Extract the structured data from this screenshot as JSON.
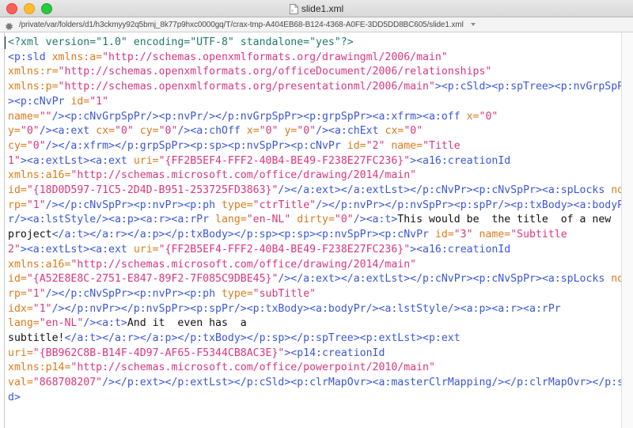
{
  "window": {
    "title": "slide1.xml",
    "doc_icon": "xml-document-icon",
    "traffic_lights": {
      "close_label": "Close",
      "minimize_label": "Minimize",
      "maximize_label": "Maximize",
      "close_color": "#ff5f57",
      "minimize_color": "#ffbd2e",
      "maximize_color": "#28c840"
    }
  },
  "pathbar": {
    "gear_icon": "gear-icon",
    "path": "/private/var/folders/d1/h3ckmyy92q5bmj_8k77p9hxc0000gq/T/crax-tmp-A404EB68-B124-4368-A0FE-3DD5DD8BC605/slide1.xml",
    "chevron_icon": "chevron-down-icon"
  },
  "colors": {
    "tag": "#3b57d8",
    "attribute": "#d97b1c",
    "value": "#d9377e",
    "text": "#111111",
    "processing_instruction": "#1f7a6c",
    "background": "#ffffff"
  },
  "document": {
    "filename": "slide1.xml",
    "declaration": "<?xml version=\"1.0\" encoding=\"UTF-8\" standalone=\"yes\"?>",
    "slide_title_text": "This would be  the title  of a new project",
    "slide_subtitle_text": "And it  even has  a subtitle!",
    "creation_id_val": "868708207",
    "title_uri": "{FF2B5EF4-FFF2-40B4-BE49-F238E27FC236}",
    "title_creation_id": "{18D0D597-71C5-2D4D-B951-253725FD3863}",
    "subtitle_creation_id": "{A52E8E8C-2751-E847-89F2-7F085C9DBE45}",
    "p14_ext_uri": "{BB962C8B-B14F-4D97-AF65-F5344CB8AC3E}",
    "ns_a": "http://schemas.openxmlformats.org/drawingml/2006/main",
    "ns_r": "http://schemas.openxmlformats.org/officeDocument/2006/relationships",
    "ns_p": "http://schemas.openxmlformats.org/presentationml/2006/main",
    "ns_a16": "http://schemas.microsoft.com/office/drawing/2014/main",
    "ns_p14": "http://schemas.microsoft.com/office/powerpoint/2010/main",
    "tokens": [
      {
        "t": "pi",
        "s": "<?xml version=\"1.0\" encoding=\"UTF-8\" standalone=\"yes\"?>\n"
      },
      {
        "t": "tag",
        "s": "<p:sld "
      },
      {
        "t": "attr",
        "s": "xmlns:a="
      },
      {
        "t": "val",
        "s": "\"http://schemas.openxmlformats.org/drawingml/2006/main\"\n"
      },
      {
        "t": "attr",
        "s": "xmlns:r="
      },
      {
        "t": "val",
        "s": "\"http://schemas.openxmlformats.org/officeDocument/2006/relationships\"\n"
      },
      {
        "t": "attr",
        "s": "xmlns:p="
      },
      {
        "t": "val",
        "s": "\"http://schemas.openxmlformats.org/presentationml/2006/main\""
      },
      {
        "t": "tag",
        "s": "><p:cSld><p:spTree><p:nvGrpSpPr><p:cNvPr "
      },
      {
        "t": "attr",
        "s": "id="
      },
      {
        "t": "val",
        "s": "\"1\"\n"
      },
      {
        "t": "attr",
        "s": "name="
      },
      {
        "t": "val",
        "s": "\"\""
      },
      {
        "t": "tag",
        "s": "/><p:cNvGrpSpPr/><p:nvPr/></p:nvGrpSpPr><p:grpSpPr><a:xfrm><a:off "
      },
      {
        "t": "attr",
        "s": "x="
      },
      {
        "t": "val",
        "s": "\"0\"\n"
      },
      {
        "t": "attr",
        "s": "y="
      },
      {
        "t": "val",
        "s": "\"0\""
      },
      {
        "t": "tag",
        "s": "/><a:ext "
      },
      {
        "t": "attr",
        "s": "cx="
      },
      {
        "t": "val",
        "s": "\"0\" "
      },
      {
        "t": "attr",
        "s": "cy="
      },
      {
        "t": "val",
        "s": "\"0\""
      },
      {
        "t": "tag",
        "s": "/><a:chOff "
      },
      {
        "t": "attr",
        "s": "x="
      },
      {
        "t": "val",
        "s": "\"0\" "
      },
      {
        "t": "attr",
        "s": "y="
      },
      {
        "t": "val",
        "s": "\"0\""
      },
      {
        "t": "tag",
        "s": "/><a:chExt "
      },
      {
        "t": "attr",
        "s": "cx="
      },
      {
        "t": "val",
        "s": "\"0\"\n"
      },
      {
        "t": "attr",
        "s": "cy="
      },
      {
        "t": "val",
        "s": "\"0\""
      },
      {
        "t": "tag",
        "s": "/></a:xfrm></p:grpSpPr><p:sp><p:nvSpPr><p:cNvPr "
      },
      {
        "t": "attr",
        "s": "id="
      },
      {
        "t": "val",
        "s": "\"2\" "
      },
      {
        "t": "attr",
        "s": "name="
      },
      {
        "t": "val",
        "s": "\"Title\n1\""
      },
      {
        "t": "tag",
        "s": "><a:extLst><a:ext "
      },
      {
        "t": "attr",
        "s": "uri="
      },
      {
        "t": "val",
        "s": "\"{FF2B5EF4-FFF2-40B4-BE49-F238E27FC236}\""
      },
      {
        "t": "tag",
        "s": "><a16:creationId\n"
      },
      {
        "t": "attr",
        "s": "xmlns:a16="
      },
      {
        "t": "val",
        "s": "\"http://schemas.microsoft.com/office/drawing/2014/main\"\n"
      },
      {
        "t": "attr",
        "s": "id="
      },
      {
        "t": "val",
        "s": "\"{18D0D597-71C5-2D4D-B951-253725FD3863}\""
      },
      {
        "t": "tag",
        "s": "/></a:ext></a:extLst></p:cNvPr><p:cNvSpPr><a:spLocks "
      },
      {
        "t": "attr",
        "s": "noGrp="
      },
      {
        "t": "val",
        "s": "\"1\""
      },
      {
        "t": "tag",
        "s": "/></p:cNvSpPr><p:nvPr><p:ph "
      },
      {
        "t": "attr",
        "s": "type="
      },
      {
        "t": "val",
        "s": "\"ctrTitle\""
      },
      {
        "t": "tag",
        "s": "/></p:nvPr></p:nvSpPr><p:spPr/><p:txBody><a:bodyPr/><a:lstStyle/><a:p><a:r><a:rPr "
      },
      {
        "t": "attr",
        "s": "lang="
      },
      {
        "t": "val",
        "s": "\"en-NL\" "
      },
      {
        "t": "attr",
        "s": "dirty="
      },
      {
        "t": "val",
        "s": "\"0\""
      },
      {
        "t": "tag",
        "s": "/><a:t>"
      },
      {
        "t": "txt",
        "s": "This would be  the title  of a new\nproject"
      },
      {
        "t": "tag",
        "s": "</a:t></a:r></a:p></p:txBody></p:sp><p:sp><p:nvSpPr><p:cNvPr "
      },
      {
        "t": "attr",
        "s": "id="
      },
      {
        "t": "val",
        "s": "\"3\" "
      },
      {
        "t": "attr",
        "s": "name="
      },
      {
        "t": "val",
        "s": "\"Subtitle\n2\""
      },
      {
        "t": "tag",
        "s": "><a:extLst><a:ext "
      },
      {
        "t": "attr",
        "s": "uri="
      },
      {
        "t": "val",
        "s": "\"{FF2B5EF4-FFF2-40B4-BE49-F238E27FC236}\""
      },
      {
        "t": "tag",
        "s": "><a16:creationId\n"
      },
      {
        "t": "attr",
        "s": "xmlns:a16="
      },
      {
        "t": "val",
        "s": "\"http://schemas.microsoft.com/office/drawing/2014/main\"\n"
      },
      {
        "t": "attr",
        "s": "id="
      },
      {
        "t": "val",
        "s": "\"{A52E8E8C-2751-E847-89F2-7F085C9DBE45}\""
      },
      {
        "t": "tag",
        "s": "/></a:ext></a:extLst></p:cNvPr><p:cNvSpPr><a:spLocks "
      },
      {
        "t": "attr",
        "s": "noGrp="
      },
      {
        "t": "val",
        "s": "\"1\""
      },
      {
        "t": "tag",
        "s": "/></p:cNvSpPr><p:nvPr><p:ph "
      },
      {
        "t": "attr",
        "s": "type="
      },
      {
        "t": "val",
        "s": "\"subTitle\"\n"
      },
      {
        "t": "attr",
        "s": "idx="
      },
      {
        "t": "val",
        "s": "\"1\""
      },
      {
        "t": "tag",
        "s": "/></p:nvPr></p:nvSpPr><p:spPr/><p:txBody><a:bodyPr/><a:lstStyle/><a:p><a:r><a:rPr\n"
      },
      {
        "t": "attr",
        "s": "lang="
      },
      {
        "t": "val",
        "s": "\"en-NL\""
      },
      {
        "t": "tag",
        "s": "/><a:t>"
      },
      {
        "t": "txt",
        "s": "And it  even has  a\nsubtitle!"
      },
      {
        "t": "tag",
        "s": "</a:t></a:r></a:p></p:txBody></p:sp></p:spTree><p:extLst><p:ext\n"
      },
      {
        "t": "attr",
        "s": "uri="
      },
      {
        "t": "val",
        "s": "\"{BB962C8B-B14F-4D97-AF65-F5344CB8AC3E}\""
      },
      {
        "t": "tag",
        "s": "><p14:creationId\n"
      },
      {
        "t": "attr",
        "s": "xmlns:p14="
      },
      {
        "t": "val",
        "s": "\"http://schemas.microsoft.com/office/powerpoint/2010/main\"\n"
      },
      {
        "t": "attr",
        "s": "val="
      },
      {
        "t": "val",
        "s": "\"868708207\""
      },
      {
        "t": "tag",
        "s": "/></p:ext></p:extLst></p:cSld><p:clrMapOvr><a:masterClrMapping/></p:clrMapOvr></p:sld>"
      }
    ]
  }
}
